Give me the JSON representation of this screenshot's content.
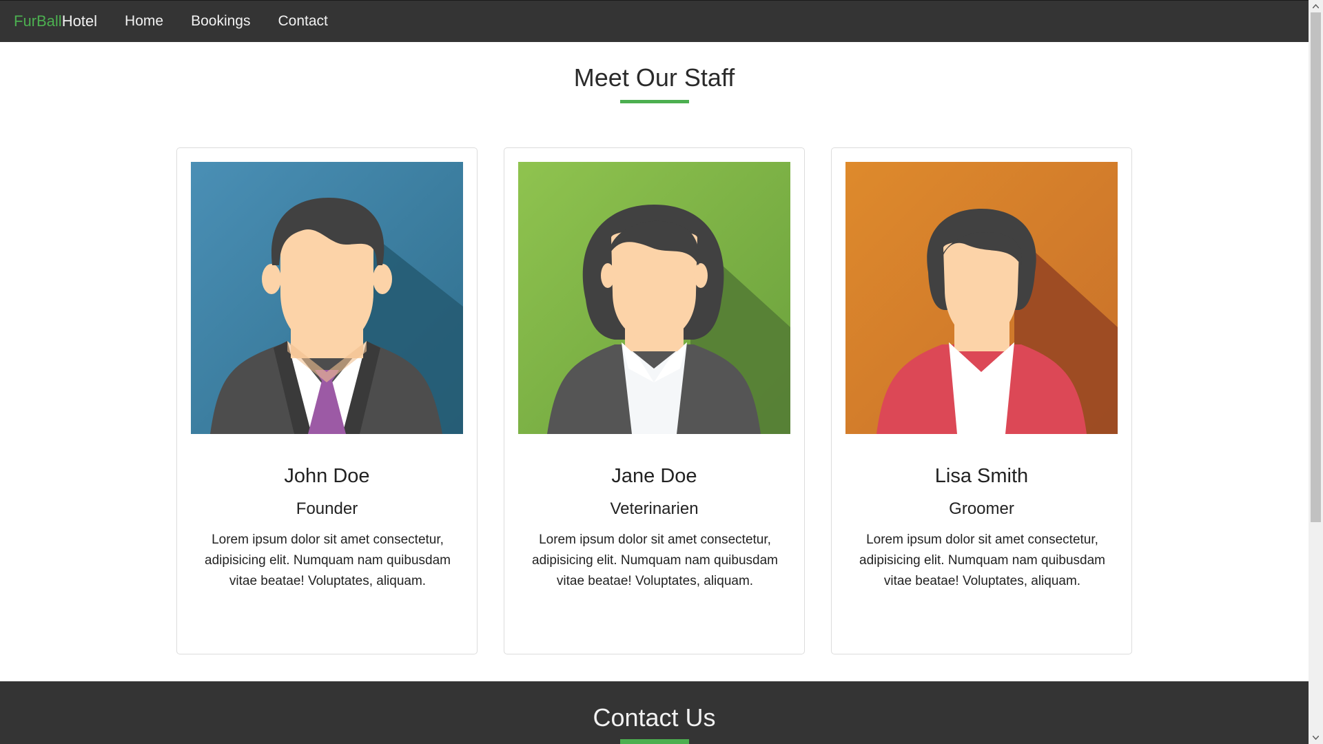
{
  "navbar": {
    "brand_primary": "FurBall",
    "brand_secondary": "Hotel",
    "links": [
      "Home",
      "Bookings",
      "Contact"
    ]
  },
  "staff_section": {
    "title": "Meet Our Staff",
    "members": [
      {
        "name": "John Doe",
        "role": "Founder",
        "description": "Lorem ipsum dolor sit amet consectetur, adipisicing elit. Numquam nam quibusdam vitae beatae! Voluptates, aliquam.",
        "avatar_icon": "businessman-avatar-icon",
        "avatar_bg": "#3b7fa0"
      },
      {
        "name": "Jane Doe",
        "role": "Veterinarien",
        "description": "Lorem ipsum dolor sit amet consectetur, adipisicing elit. Numquam nam quibusdam vitae beatae! Voluptates, aliquam.",
        "avatar_icon": "businesswoman-avatar-icon",
        "avatar_bg": "#7ab648"
      },
      {
        "name": "Lisa Smith",
        "role": "Groomer",
        "description": "Lorem ipsum dolor sit amet consectetur, adipisicing elit. Numquam nam quibusdam vitae beatae! Voluptates, aliquam.",
        "avatar_icon": "woman-avatar-icon",
        "avatar_bg": "#d47f28"
      }
    ]
  },
  "contact_section": {
    "title": "Contact Us"
  },
  "colors": {
    "accent": "#4caf50",
    "navbar_bg": "#343434",
    "footer_bg": "#343434"
  }
}
